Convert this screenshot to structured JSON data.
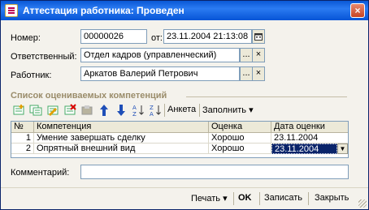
{
  "window": {
    "title": "Аттестация работника: Проведен",
    "close_label": "×"
  },
  "form": {
    "number_label": "Номер:",
    "number_value": "00000026",
    "date_label": "от:",
    "date_value": "23.11.2004 21:13:08",
    "responsible_label": "Ответственный:",
    "responsible_value": "Отдел кадров (управленческий)",
    "employee_label": "Работник:",
    "employee_value": "Аркатов Валерий Петрович",
    "select_glyph": "...",
    "clear_glyph": "×"
  },
  "competencies": {
    "section_title": "Список оцениваемых компетенций",
    "toolbar": {
      "questionnaire_label": "Анкета",
      "fill_label": "Заполнить",
      "fill_arrow": "▾"
    },
    "columns": [
      "№",
      "Компетенция",
      "Оценка",
      "Дата оценки"
    ],
    "rows": [
      {
        "num": "1",
        "competency": "Умение завершать сделку",
        "grade": "Хорошо",
        "date": "23.11.2004"
      },
      {
        "num": "2",
        "competency": "Опрятный внешний вид",
        "grade": "Хорошо",
        "date": "23.11.2004"
      }
    ]
  },
  "comment": {
    "label": "Комментарий:",
    "value": ""
  },
  "bottom": {
    "print_label": "Печать",
    "print_arrow": "▾",
    "ok_label": "OK",
    "save_label": "Записать",
    "close_label": "Закрыть"
  },
  "colors": {
    "titlebar": "#0a58d6",
    "window_bg": "#f4f2ec",
    "selection": "#0a246a",
    "section_title": "#9a8c6a"
  }
}
